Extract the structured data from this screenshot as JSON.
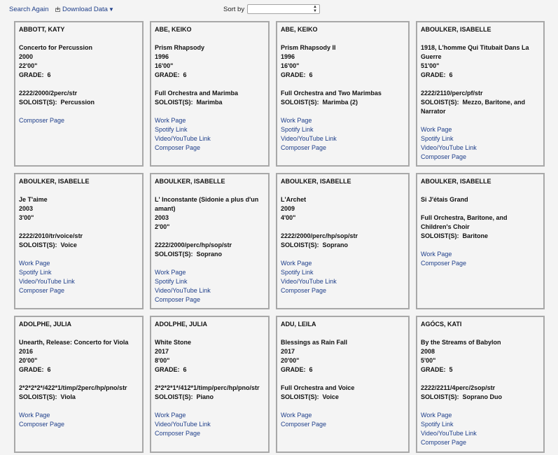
{
  "toolbar": {
    "search_again": "Search Again",
    "download_data": "Download Data",
    "sort_label": "Sort by",
    "sort_value": ""
  },
  "cards": [
    {
      "composer": "ABBOTT, KATY",
      "title": [
        "Concerto for Percussion"
      ],
      "year": "2000",
      "duration": "22'00\"",
      "grade": "6",
      "instrumentation": [
        "2222/2000/2perc/str"
      ],
      "soloists_label": "SOLOIST(S):",
      "soloists": [
        "Percussion"
      ],
      "links": [
        "Composer Page"
      ]
    },
    {
      "composer": "ABE, KEIKO",
      "title": [
        "Prism Rhapsody"
      ],
      "year": "1996",
      "duration": "16'00\"",
      "grade": "6",
      "instrumentation": [
        "Full Orchestra and Marimba"
      ],
      "soloists_label": "SOLOIST(S):",
      "soloists": [
        "Marimba"
      ],
      "links": [
        "Work Page",
        "Spotify Link",
        "Video/YouTube Link",
        "Composer Page"
      ]
    },
    {
      "composer": "ABE, KEIKO",
      "title": [
        "Prism Rhapsody II"
      ],
      "year": "1996",
      "duration": "16'00\"",
      "grade": "6",
      "instrumentation": [
        "Full Orchestra and Two Marimbas"
      ],
      "soloists_label": "SOLOIST(S):",
      "soloists": [
        "Marimba (2)"
      ],
      "links": [
        "Work Page",
        "Spotify Link",
        "Video/YouTube Link",
        "Composer Page"
      ]
    },
    {
      "composer": "ABOULKER, ISABELLE",
      "title": [
        "1918, L'homme Qui Titubait Dans La",
        "Guerre"
      ],
      "year": "",
      "duration": "51'00\"",
      "grade": "6",
      "instrumentation": [
        "2222/2110/perc/pf/str"
      ],
      "soloists_label": "SOLOIST(S):",
      "soloists": [
        "Mezzo, Baritone, and",
        "Narrator"
      ],
      "links": [
        "Work Page",
        "Spotify Link",
        "Video/YouTube Link",
        "Composer Page"
      ]
    },
    {
      "composer": "ABOULKER, ISABELLE",
      "title": [
        "Je T'aime"
      ],
      "year": "2003",
      "duration": "3'00\"",
      "grade": "",
      "instrumentation": [
        "2222/2010/tr/voice/str"
      ],
      "soloists_label": "SOLOIST(S):",
      "soloists": [
        "Voice"
      ],
      "links": [
        "Work Page",
        "Spotify Link",
        "Video/YouTube Link",
        "Composer Page"
      ]
    },
    {
      "composer": "ABOULKER, ISABELLE",
      "title": [
        "L' Inconstante (Sidonie a plus d'un",
        "amant)"
      ],
      "year": "2003",
      "duration": "2'00\"",
      "grade": "",
      "instrumentation": [
        "2222/2000/perc/hp/sop/str"
      ],
      "soloists_label": "SOLOIST(S):",
      "soloists": [
        "Soprano"
      ],
      "links": [
        "Work Page",
        "Spotify Link",
        "Video/YouTube Link",
        "Composer Page"
      ]
    },
    {
      "composer": "ABOULKER, ISABELLE",
      "title": [
        "L'Archet"
      ],
      "year": "2009",
      "duration": "4'00\"",
      "grade": "",
      "instrumentation": [
        "2222/2000/perc/hp/sop/str"
      ],
      "soloists_label": "SOLOIST(S):",
      "soloists": [
        "Soprano"
      ],
      "links": [
        "Work Page",
        "Spotify Link",
        "Video/YouTube Link",
        "Composer Page"
      ]
    },
    {
      "composer": "ABOULKER, ISABELLE",
      "title": [
        "Si J'étais Grand"
      ],
      "year": "",
      "duration": "",
      "grade": "",
      "instrumentation": [
        "Full Orchestra, Baritone, and",
        "Children's Choir"
      ],
      "soloists_label": "SOLOIST(S):",
      "soloists": [
        "Baritone"
      ],
      "links": [
        "Work Page",
        "Composer Page"
      ]
    },
    {
      "composer": "ADOLPHE, JULIA",
      "title": [
        "Unearth, Release: Concerto for Viola"
      ],
      "year": "2016",
      "duration": "20'00\"",
      "grade": "6",
      "instrumentation": [
        "2*2*2*2*/422*1/timp/2perc/hp/pno/str"
      ],
      "soloists_label": "SOLOIST(S):",
      "soloists": [
        "Viola"
      ],
      "links": [
        "Work Page",
        "Composer Page"
      ]
    },
    {
      "composer": "ADOLPHE, JULIA",
      "title": [
        "White Stone"
      ],
      "year": "2017",
      "duration": "8'00\"",
      "grade": "6",
      "instrumentation": [
        "2*2*2*1*/412*1/timp/perc/hp/pno/str"
      ],
      "soloists_label": "SOLOIST(S):",
      "soloists": [
        "Piano"
      ],
      "links": [
        "Work Page",
        "Video/YouTube Link",
        "Composer Page"
      ]
    },
    {
      "composer": "ADU, LEILA",
      "title": [
        "Blessings as Rain Fall"
      ],
      "year": "2017",
      "duration": "20'00\"",
      "grade": "6",
      "instrumentation": [
        "Full Orchestra and Voice"
      ],
      "soloists_label": "SOLOIST(S):",
      "soloists": [
        "Voice"
      ],
      "links": [
        "Work Page",
        "Composer Page"
      ]
    },
    {
      "composer": "AGÓCS, KATI",
      "title": [
        "By the Streams of Babylon"
      ],
      "year": "2008",
      "duration": "5'00\"",
      "grade": "5",
      "instrumentation": [
        "2222/2211/4perc/2sop/str"
      ],
      "soloists_label": "SOLOIST(S):",
      "soloists": [
        "Soprano Duo"
      ],
      "links": [
        "Work Page",
        "Spotify Link",
        "Video/YouTube Link",
        "Composer Page"
      ]
    }
  ]
}
